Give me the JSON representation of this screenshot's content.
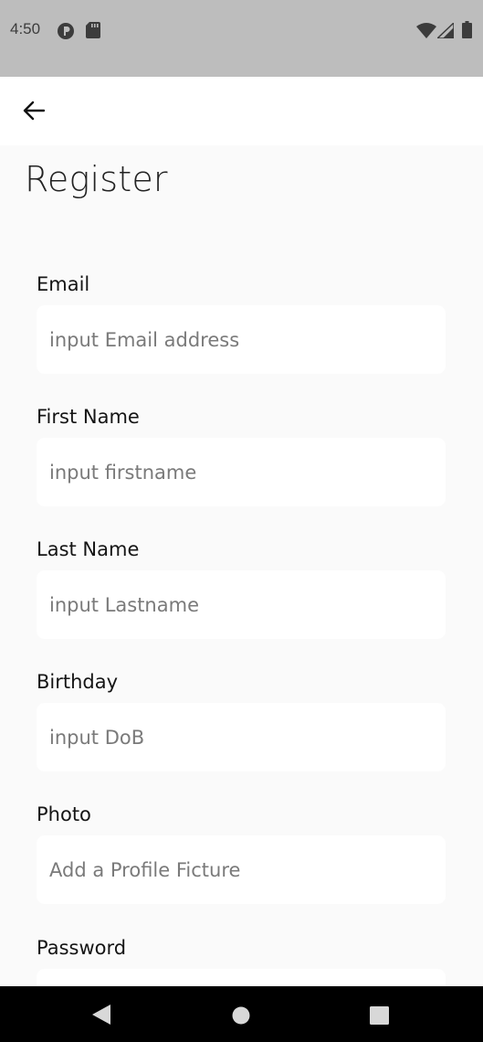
{
  "status_bar": {
    "time": "4:50",
    "left_icons": [
      "record-icon",
      "sd-card-icon"
    ],
    "right_icons": [
      "wifi-icon",
      "signal-icon",
      "battery-icon"
    ]
  },
  "app_bar": {
    "back_icon": "arrow-left-icon"
  },
  "page": {
    "title": "Register"
  },
  "form": {
    "fields": [
      {
        "label": "Email",
        "placeholder": "input Email address"
      },
      {
        "label": "First Name",
        "placeholder": "input firstname"
      },
      {
        "label": "Last Name",
        "placeholder": "input Lastname"
      },
      {
        "label": "Birthday",
        "placeholder": "input DoB"
      },
      {
        "label": "Photo",
        "placeholder": "Add a Profile Ficture"
      },
      {
        "label": "Password",
        "placeholder": ""
      }
    ]
  },
  "nav_bar": {
    "buttons": [
      "back-triangle-icon",
      "home-circle-icon",
      "recents-square-icon"
    ]
  },
  "colors": {
    "status_bar": "#bdbdbd",
    "app_bar": "#ffffff",
    "background": "#fafafa",
    "input_background": "#ffffff",
    "placeholder": "#7a7a7a",
    "nav_bar": "#000000"
  }
}
